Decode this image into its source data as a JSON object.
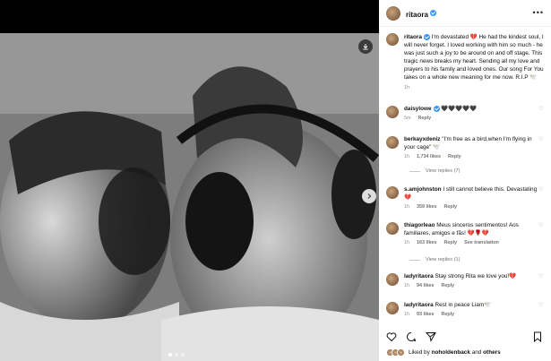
{
  "post": {
    "username": "ritaora",
    "more_icon": "more-horizontal-icon",
    "caption": "I'm devastated 💔 He had the kindest soul, I will never forget. I loved working with him so much - he was just such a joy to be around on and off stage. This tragic news breaks my heart. Sending all my love and prayers to his family and loved ones. Our song For You takes on a whole new meaning for me now. R.I.P 🕊️",
    "time": "1h"
  },
  "comments": [
    {
      "user": "daisylowe",
      "verified": true,
      "text": "🖤🖤🖤🖤🖤",
      "time": "5m",
      "likes": "",
      "reply": "Reply",
      "translate": "",
      "view_replies": ""
    },
    {
      "user": "berkayxdeniz",
      "verified": false,
      "text": "\"I'm free as a bird,when I'm flying in your cage\" 🕊️",
      "time": "1h",
      "likes": "1,734 likes",
      "reply": "Reply",
      "translate": "",
      "view_replies": "View replies (7)"
    },
    {
      "user": "s.amjohnston",
      "verified": false,
      "text": "I still cannot believe this. Devastating 💔",
      "time": "1h",
      "likes": "359 likes",
      "reply": "Reply",
      "translate": "",
      "view_replies": ""
    },
    {
      "user": "thiagorleao",
      "verified": false,
      "text": "Meus sinceros sentimentos! Aos familiares, amigos e fãs! 💔🌹💔",
      "time": "1h",
      "likes": "163 likes",
      "reply": "Reply",
      "translate": "See translation",
      "view_replies": "View replies (1)"
    },
    {
      "user": "ladyritaora",
      "verified": false,
      "text": "Stay strong Rita we love you!💔",
      "time": "1h",
      "likes": "94 likes",
      "reply": "Reply",
      "translate": "",
      "view_replies": ""
    },
    {
      "user": "ladyritaora",
      "verified": false,
      "text": "Rest in peace Liam🕊️",
      "time": "1h",
      "likes": "93 likes",
      "reply": "Reply",
      "translate": "",
      "view_replies": ""
    }
  ],
  "footer": {
    "liked_by_prefix": "Liked by",
    "liked_by_user": "noholdenback",
    "liked_by_suffix": "and",
    "liked_by_others": "others"
  },
  "icons": {
    "download": "download-icon",
    "next": "chevron-right-icon",
    "like": "heart-icon",
    "comment": "comment-icon",
    "share": "send-icon",
    "save": "bookmark-icon"
  },
  "colors": {
    "verified": "#3897f0",
    "meta": "#8e8e8e",
    "text": "#111111"
  }
}
